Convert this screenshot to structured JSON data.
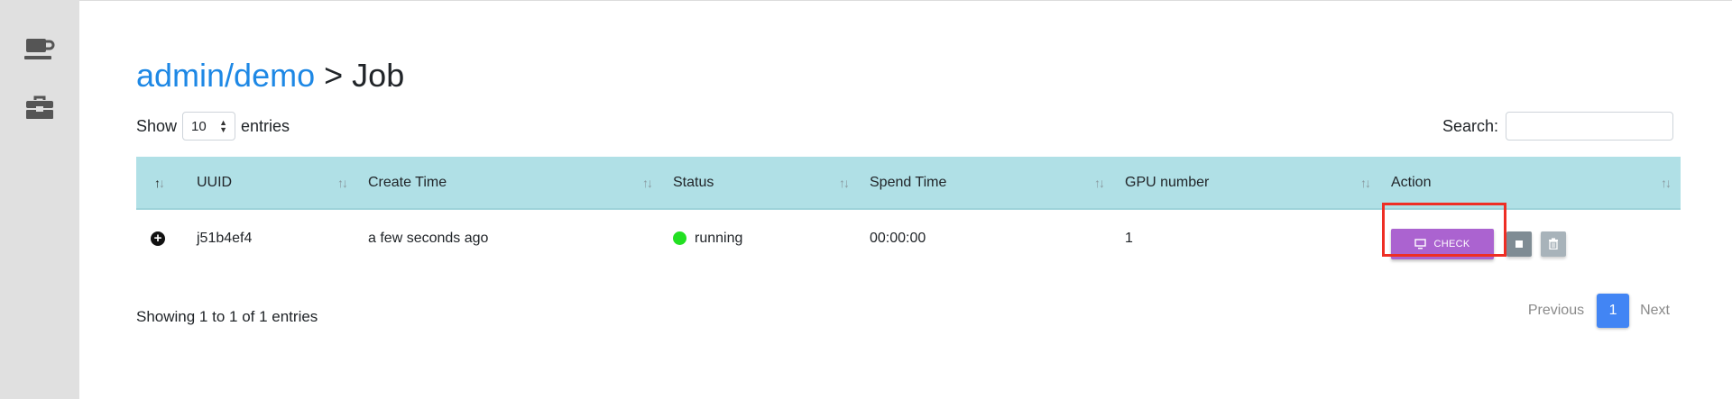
{
  "sidebar": {
    "items": [
      {
        "icon": "coffee-cup-icon"
      },
      {
        "icon": "toolbox-icon"
      }
    ]
  },
  "header": {
    "breadcrumb_link": "admin/demo",
    "separator": ">",
    "page_title": "Job"
  },
  "length_menu": {
    "prefix": "Show",
    "selected": "10",
    "suffix": "entries"
  },
  "search": {
    "label": "Search:",
    "value": ""
  },
  "table": {
    "columns": [
      "UUID",
      "Create Time",
      "Status",
      "Spend Time",
      "GPU number",
      "Action"
    ],
    "rows": [
      {
        "uuid": "j51b4ef4",
        "create_time": "a few seconds ago",
        "status": "running",
        "status_color": "#22e022",
        "spend_time": "00:00:00",
        "gpu_number": "1"
      }
    ],
    "actions": {
      "check_label": "CHECK",
      "check_color": "#ab63d0"
    }
  },
  "footer": {
    "info": "Showing 1 to 1 of 1 entries",
    "previous": "Previous",
    "current_page": "1",
    "next": "Next"
  },
  "colors": {
    "accent": "#1e88e5",
    "header_bg": "#b0e0e6",
    "highlight": "#ee2e24",
    "pager_active": "#4285f4"
  }
}
